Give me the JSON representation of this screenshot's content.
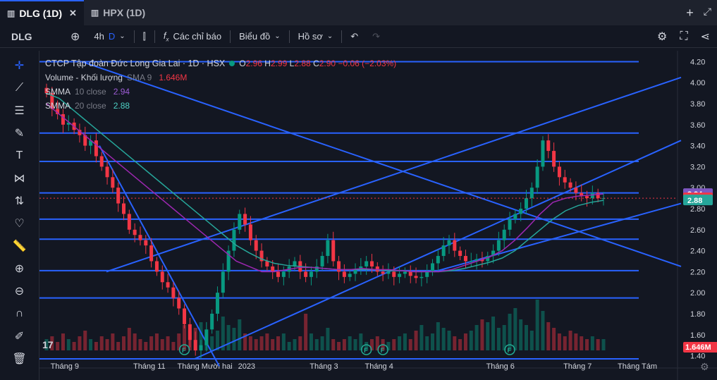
{
  "tabs": [
    {
      "label": "DLG (1D)",
      "icon": "chart-icon",
      "active": true
    },
    {
      "label": "HPX (1D)",
      "icon": "chart-icon",
      "active": false
    }
  ],
  "toolbar": {
    "symbol": "DLG",
    "interval": "4h",
    "interval_alt": "D",
    "indicators_label": "Các chỉ báo",
    "chart_type_label": "Biểu đồ",
    "profile_label": "Hồ sơ"
  },
  "legend": {
    "title": "CTCP Tập đoàn Đức Long Gia Lai · 1D · HSX",
    "o_label": "O",
    "o": "2.96",
    "h_label": "H",
    "h": "2.99",
    "l_label": "L",
    "l": "2.88",
    "c_label": "C",
    "c": "2.90",
    "change": "−0.06 (−2.03%)",
    "volume_label": "Volume - Khối lượng",
    "volume_ma": "SMA 9",
    "volume_value": "1.646M",
    "smma10_label": "SMMA",
    "smma10_param": "10 close",
    "smma10_value": "2.94",
    "smma20_label": "SMMA",
    "smma20_param": "20 close",
    "smma20_value": "2.88"
  },
  "colors": {
    "up": "#089981",
    "down": "#f23645",
    "smma10": "#9c27b0",
    "smma20": "#26a69a",
    "drawing": "#2962ff",
    "background": "#131722"
  },
  "price_badges": {
    "smma10": "2.94",
    "last": "2.90",
    "smma20": "2.88",
    "volume": "1.646M"
  },
  "chart_data": {
    "type": "candlestick",
    "title": "CTCP Tập đoàn Đức Long Gia Lai · 1D · HSX",
    "x_ticks": [
      "Tháng 9",
      "Tháng 11",
      "Tháng Mười hai",
      "2023",
      "Tháng 3",
      "Tháng 4",
      "Tháng 6",
      "Tháng 7",
      "Tháng Tám"
    ],
    "y_ticks": [
      "4.20",
      "4.00",
      "3.80",
      "3.60",
      "3.40",
      "3.20",
      "3.00",
      "2.80",
      "2.60",
      "2.40",
      "2.20",
      "2.00",
      "1.80",
      "1.60",
      "1.40"
    ],
    "ylim": [
      1.35,
      4.25
    ],
    "close_series": [
      3.9,
      3.75,
      3.7,
      3.6,
      3.62,
      3.55,
      3.5,
      3.4,
      3.45,
      3.3,
      3.2,
      3.1,
      3.0,
      2.85,
      2.75,
      2.6,
      2.55,
      2.5,
      2.45,
      2.3,
      2.2,
      2.1,
      2.05,
      1.95,
      1.85,
      1.7,
      1.55,
      1.45,
      1.5,
      1.65,
      1.8,
      2.0,
      2.2,
      2.4,
      2.6,
      2.75,
      2.65,
      2.5,
      2.4,
      2.3,
      2.25,
      2.2,
      2.15,
      2.2,
      2.25,
      2.3,
      2.2,
      2.15,
      2.2,
      2.25,
      2.35,
      2.5,
      2.3,
      2.2,
      2.15,
      2.18,
      2.22,
      2.25,
      2.3,
      2.25,
      2.2,
      2.18,
      2.2,
      2.15,
      2.18,
      2.2,
      2.16,
      2.14,
      2.15,
      2.2,
      2.28,
      2.35,
      2.45,
      2.5,
      2.4,
      2.35,
      2.3,
      2.3,
      2.32,
      2.3,
      2.35,
      2.4,
      2.5,
      2.6,
      2.7,
      2.75,
      2.8,
      2.9,
      3.0,
      3.2,
      3.45,
      3.35,
      3.2,
      3.1,
      3.05,
      3.0,
      2.95,
      2.92,
      2.9,
      2.95,
      2.9,
      2.9
    ],
    "smma10": [
      3.8,
      3.7,
      3.6,
      3.5,
      3.4,
      3.3,
      3.2,
      3.1,
      3.0,
      2.9,
      2.8,
      2.7,
      2.6,
      2.5,
      2.4,
      2.3,
      2.25,
      2.2,
      2.2,
      2.22,
      2.24,
      2.24,
      2.23,
      2.22,
      2.22,
      2.23,
      2.22,
      2.22,
      2.21,
      2.2,
      2.2,
      2.2,
      2.22,
      2.26,
      2.3,
      2.34,
      2.4,
      2.5,
      2.62,
      2.75,
      2.86,
      2.9,
      2.92,
      2.93,
      2.94
    ],
    "smma20": [
      3.9,
      3.85,
      3.75,
      3.65,
      3.55,
      3.45,
      3.35,
      3.25,
      3.15,
      3.05,
      2.95,
      2.85,
      2.75,
      2.65,
      2.55,
      2.45,
      2.38,
      2.32,
      2.28,
      2.26,
      2.25,
      2.24,
      2.23,
      2.22,
      2.22,
      2.22,
      2.22,
      2.21,
      2.21,
      2.2,
      2.2,
      2.2,
      2.21,
      2.23,
      2.26,
      2.29,
      2.33,
      2.4,
      2.5,
      2.6,
      2.7,
      2.78,
      2.83,
      2.86,
      2.88
    ],
    "horizontal_levels": [
      4.2,
      3.52,
      3.25,
      2.95,
      2.7,
      2.51,
      2.21,
      1.95,
      1.37
    ],
    "legend_position": "top-left"
  }
}
